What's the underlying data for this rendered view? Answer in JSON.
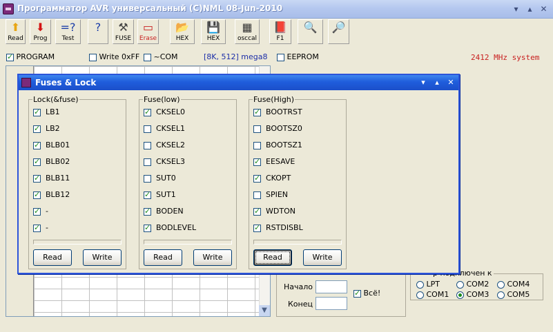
{
  "window": {
    "title": "Программатор AVR универсальный (C)NML 08-Jun-2010"
  },
  "toolbar": [
    {
      "label": "Read",
      "icon": "arrow-up-icon",
      "glyph": "⬆",
      "color": "#e8a514"
    },
    {
      "label": "Prog",
      "icon": "arrow-down-icon",
      "glyph": "⬇",
      "color": "#d41414"
    },
    {
      "label": "Test",
      "icon": "test-icon",
      "glyph": "=?",
      "color": "#1c3ea8"
    },
    {
      "label": "",
      "icon": "help-icon",
      "glyph": "?",
      "color": "#1c3ea8"
    },
    {
      "label": "FUSE",
      "icon": "tools-icon",
      "glyph": "⚒",
      "color": "#444444"
    },
    {
      "label": "Erase",
      "icon": "eraser-icon",
      "glyph": "▭",
      "color": "#c81e1e"
    },
    {
      "label": "HEX",
      "icon": "open-folder-icon",
      "glyph": "📂",
      "color": "#555555"
    },
    {
      "label": "HEX",
      "icon": "save-disk-icon",
      "glyph": "💾",
      "color": "#555555"
    },
    {
      "label": "osccal",
      "icon": "chip-icon",
      "glyph": "▦",
      "color": "#333333"
    },
    {
      "label": "F1",
      "icon": "book-icon",
      "glyph": "📕",
      "color": "#7b2a7a"
    },
    {
      "label": "",
      "icon": "magnifier-icon",
      "glyph": "🔍",
      "color": "#c81e1e"
    },
    {
      "label": "",
      "icon": "magnifier-small-icon",
      "glyph": "🔎",
      "color": "#c81e1e"
    }
  ],
  "options": {
    "program_label": "PROGRAM",
    "program_checked": true,
    "write_label": "Write 0xFF",
    "write_checked": false,
    "com_label": "~COM",
    "com_checked": false,
    "memory_info": "[8K, 512]",
    "chip": "mega8",
    "eeprom_label": "EEPROM",
    "eeprom_checked": false,
    "frequency": "2412 MHz system"
  },
  "range": {
    "start_label": "Начало :",
    "end_label": "Конец :",
    "all_label": "Всё!",
    "all_checked": true
  },
  "port": {
    "legend": "р подключен к",
    "selected": "COM3",
    "options": [
      "LPT",
      "COM2",
      "COM4",
      "COM1",
      "COM3",
      "COM5"
    ]
  },
  "dialog": {
    "title": "Fuses & Lock",
    "groups": [
      {
        "legend": "Lock(&fuse)",
        "items": [
          {
            "label": "LB1",
            "checked": true
          },
          {
            "label": "LB2",
            "checked": true
          },
          {
            "label": "BLB01",
            "checked": true
          },
          {
            "label": "BLB02",
            "checked": true
          },
          {
            "label": "BLB11",
            "checked": true
          },
          {
            "label": "BLB12",
            "checked": true
          },
          {
            "label": "-",
            "checked": true
          },
          {
            "label": "-",
            "checked": true
          }
        ],
        "read_label": "Read",
        "write_label": "Write"
      },
      {
        "legend": "Fuse(low)",
        "items": [
          {
            "label": "CKSEL0",
            "checked": true
          },
          {
            "label": "CKSEL1",
            "checked": false
          },
          {
            "label": "CKSEL2",
            "checked": false
          },
          {
            "label": "CKSEL3",
            "checked": false
          },
          {
            "label": "SUT0",
            "checked": false
          },
          {
            "label": "SUT1",
            "checked": true
          },
          {
            "label": "BODEN",
            "checked": true
          },
          {
            "label": "BODLEVEL",
            "checked": true
          }
        ],
        "read_label": "Read",
        "write_label": "Write"
      },
      {
        "legend": "Fuse(High)",
        "items": [
          {
            "label": "BOOTRST",
            "checked": true
          },
          {
            "label": "BOOTSZ0",
            "checked": false
          },
          {
            "label": "BOOTSZ1",
            "checked": false
          },
          {
            "label": "EESAVE",
            "checked": true
          },
          {
            "label": "CKOPT",
            "checked": true
          },
          {
            "label": "SPIEN",
            "checked": false
          },
          {
            "label": "WDTON",
            "checked": true
          },
          {
            "label": "RSTDISBL",
            "checked": true
          }
        ],
        "read_label": "Read",
        "write_label": "Write"
      }
    ]
  }
}
